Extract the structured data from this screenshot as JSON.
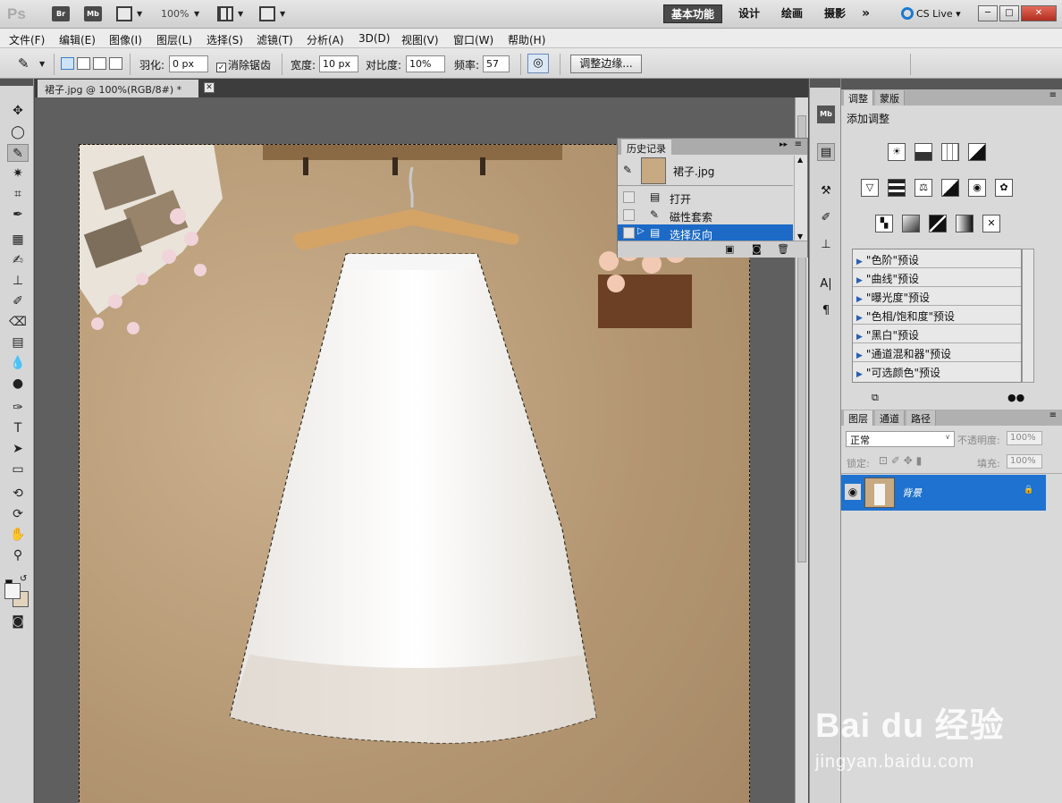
{
  "app": {
    "logo": "Ps",
    "bridge": "Br",
    "minibridge": "Mb",
    "zoom": "100%",
    "workspaces": [
      "基本功能",
      "设计",
      "绘画",
      "摄影"
    ],
    "more": "»",
    "cslive": "CS Live"
  },
  "menu": [
    "文件(F)",
    "编辑(E)",
    "图像(I)",
    "图层(L)",
    "选择(S)",
    "滤镜(T)",
    "分析(A)",
    "3D(D)",
    "视图(V)",
    "窗口(W)",
    "帮助(H)"
  ],
  "options": {
    "feather_label": "羽化:",
    "feather_value": "0 px",
    "antialias_label": "消除锯齿",
    "width_label": "宽度:",
    "width_value": "10 px",
    "contrast_label": "对比度:",
    "contrast_value": "10%",
    "frequency_label": "频率:",
    "frequency_value": "57",
    "refine_edge": "调整边缘..."
  },
  "document": {
    "tab_title": "裙子.jpg @ 100%(RGB/8#) *"
  },
  "history": {
    "tab": "历史记录",
    "snapshot": "裙子.jpg",
    "items": [
      "打开",
      "磁性套索",
      "选择反向"
    ],
    "selected_index": 2
  },
  "adjustments": {
    "tabs": [
      "调整",
      "蒙版"
    ],
    "title": "添加调整",
    "presets": [
      "\"色阶\"预设",
      "\"曲线\"预设",
      "\"曝光度\"预设",
      "\"色相/饱和度\"预设",
      "\"黑白\"预设",
      "\"通道混和器\"预设",
      "\"可选颜色\"预设"
    ]
  },
  "layers": {
    "tabs": [
      "图层",
      "通道",
      "路径"
    ],
    "blend_mode": "正常",
    "opacity_label": "不透明度:",
    "opacity_value": "100%",
    "lock_label": "锁定:",
    "fill_label": "填充:",
    "fill_value": "100%",
    "layer_name": "背景"
  },
  "watermark": {
    "top": "Bai du 经验",
    "bottom": "jingyan.baidu.com"
  },
  "colors": {
    "accent_blue": "#1f72cf",
    "canvas_beige": "#b8996f"
  }
}
